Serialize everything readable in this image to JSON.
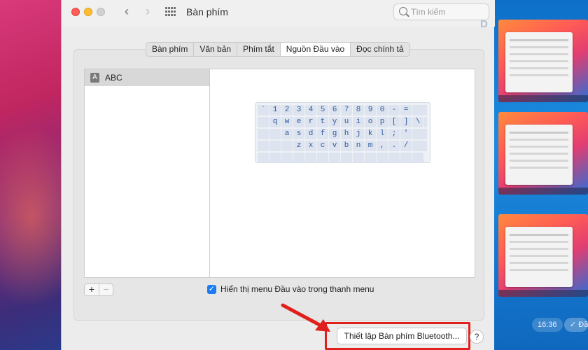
{
  "window": {
    "title": "Bàn phím",
    "search_placeholder": "Tìm kiếm"
  },
  "tabs": [
    {
      "label": "Bàn phím"
    },
    {
      "label": "Văn bản"
    },
    {
      "label": "Phím tắt"
    },
    {
      "label": "Nguồn Đầu vào",
      "active": true
    },
    {
      "label": "Đọc chính tả"
    }
  ],
  "input_sources": {
    "items": [
      {
        "label": "ABC",
        "icon": "A"
      }
    ],
    "add_label": "+",
    "remove_label": "−"
  },
  "keyboard_preview": {
    "rows": [
      "`1234567890-=",
      "qwertyuiop[]\\",
      "asdfghjkl;'",
      "zxcvbnm,./"
    ]
  },
  "show_menu_checkbox": {
    "label": "Hiển thị menu Đầu vào trong thanh menu",
    "checked": true
  },
  "footer": {
    "bluetooth_button": "Thiết lập Bàn phím Bluetooth...",
    "help_label": "?"
  },
  "background_chat": {
    "time": "16:36",
    "status": "✓ Đã"
  },
  "colors": {
    "highlight": "#e0201c",
    "accent": "#1a7bf2"
  }
}
